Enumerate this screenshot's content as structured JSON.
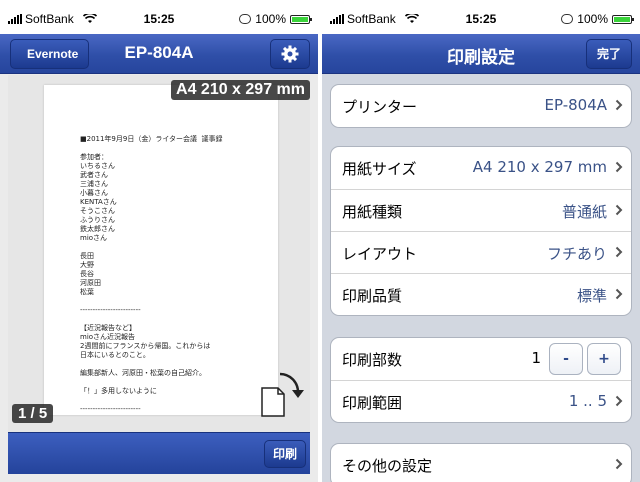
{
  "left": {
    "status": {
      "carrier": "SoftBank",
      "time": "15:25",
      "battery": "100%"
    },
    "nav": {
      "back_label": "Evernote",
      "title": "EP-804A",
      "settings_icon": "gear-icon"
    },
    "preview": {
      "size_badge": "A4 210 x 297 mm",
      "page_indicator": "1 / 5",
      "document_lines": [
        "■2011年9月9日（金）ライター会議  議事録",
        "",
        "参加者：",
        "いちるさん",
        "武者さん",
        "三浦さん",
        "小暮さん",
        "KENTAさん",
        "そうこさん",
        "ふうりさん",
        "鉄太郎さん",
        "mioさん",
        "",
        "長田",
        "大野",
        "長谷",
        "河原田",
        "松葉",
        "",
        "------------------------",
        "",
        "【近況報告など】",
        "mioさん近況報告",
        "2週間前にフランスから帰国。これからは",
        "日本にいるとのこと。",
        "",
        "編集部新人、河原田・松葉の自己紹介。",
        "",
        "「！」多用しないように",
        "",
        "------------------------"
      ]
    },
    "toolbar": {
      "print_label": "印刷"
    }
  },
  "right": {
    "status": {
      "carrier": "SoftBank",
      "time": "15:25",
      "battery": "100%"
    },
    "nav": {
      "title": "印刷設定",
      "done_label": "完了"
    },
    "groups": {
      "printer": [
        {
          "label": "プリンター",
          "value": "EP-804A"
        }
      ],
      "paper": [
        {
          "label": "用紙サイズ",
          "value": "A4 210 x 297 mm"
        },
        {
          "label": "用紙種類",
          "value": "普通紙"
        },
        {
          "label": "レイアウト",
          "value": "フチあり"
        },
        {
          "label": "印刷品質",
          "value": "標準"
        }
      ],
      "copies": {
        "count_label": "印刷部数",
        "count_value": "1",
        "minus": "-",
        "plus": "+",
        "range_label": "印刷範囲",
        "range_value": "1 .. 5"
      },
      "other": {
        "label": "その他の設定"
      }
    }
  },
  "colors": {
    "nav_blue": "#2f4fa8",
    "value_blue": "#3a5287",
    "battery_green": "#3ad33a"
  }
}
